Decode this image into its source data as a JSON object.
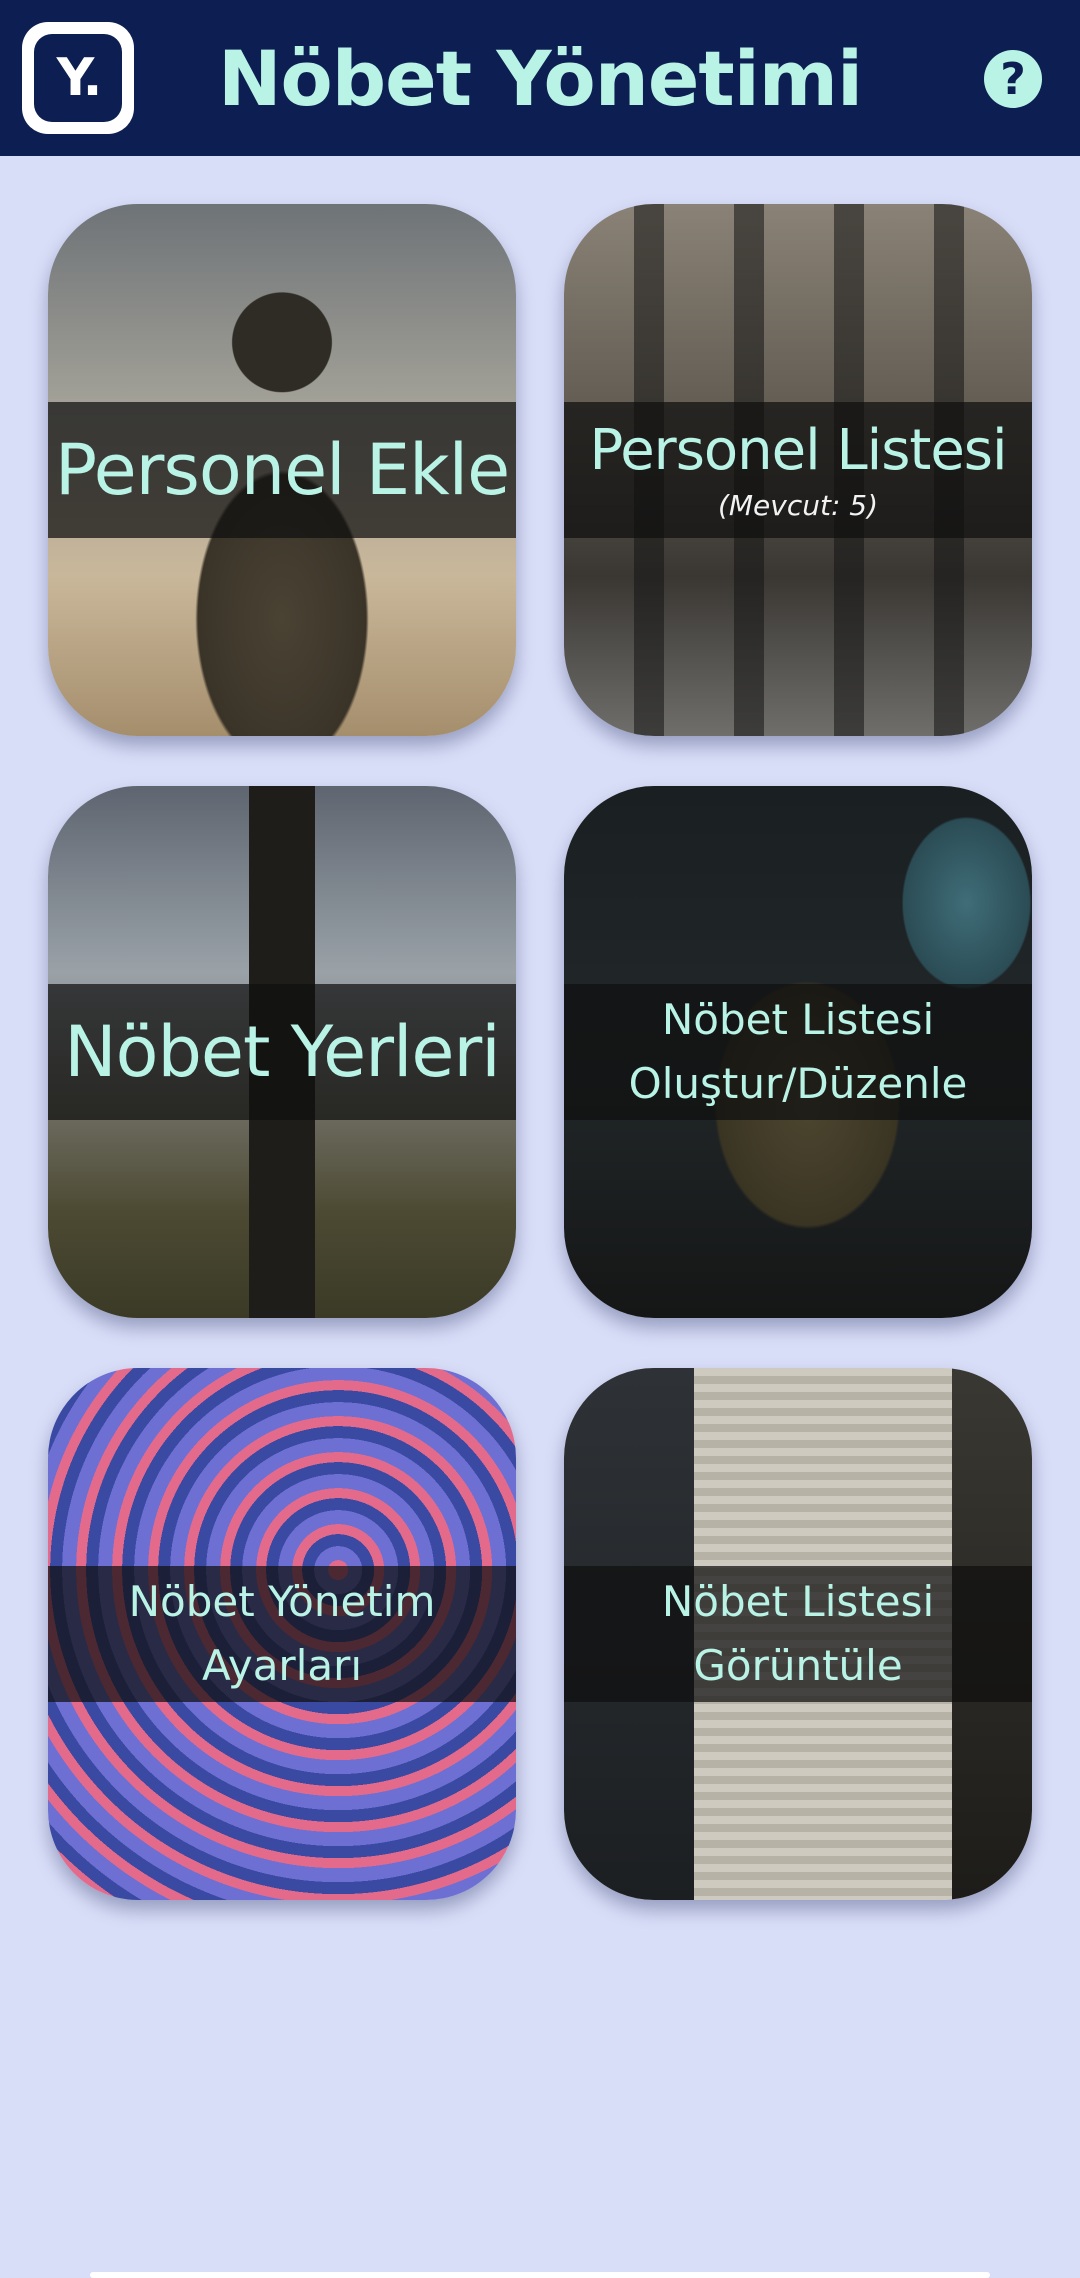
{
  "app": {
    "title": "Nöbet Yönetimi",
    "logo_text": "Y.",
    "help_glyph": "?"
  },
  "colors": {
    "appbar": "#0d1f52",
    "background": "#d9def8",
    "accent_text": "#b9f3e6"
  },
  "cards": [
    {
      "label": "Personel Ekle",
      "subtitle": ""
    },
    {
      "label": "Personel Listesi",
      "subtitle": "(Mevcut: 5)"
    },
    {
      "label": "Nöbet Yerleri",
      "subtitle": ""
    },
    {
      "label": "Nöbet Listesi\nOluştur/Düzenle",
      "subtitle": ""
    },
    {
      "label": "Nöbet Yönetim\nAyarları",
      "subtitle": ""
    },
    {
      "label": "Nöbet Listesi\nGörüntüle",
      "subtitle": ""
    }
  ],
  "icons": {
    "logo": "app-logo-icon",
    "help": "help-icon"
  }
}
